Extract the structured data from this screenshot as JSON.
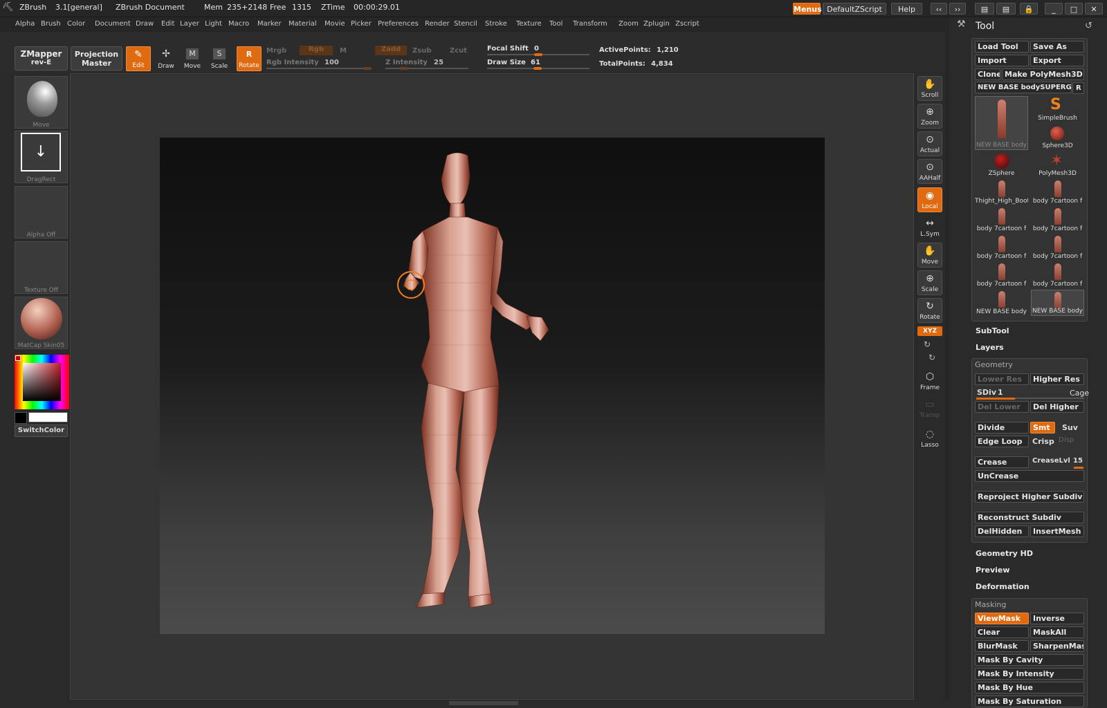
{
  "titlebar": {
    "app": "ZBrush",
    "version": "3.1[general]",
    "doc": "ZBrush Document",
    "mem_label": "Mem",
    "mem_value": "235+2148",
    "free_label": "Free",
    "free_value": "1315",
    "ztime_label": "ZTime",
    "ztime_value": "00:00:29.01",
    "menus_btn": "Menus",
    "script_btn": "DefaultZScript",
    "help_btn": "Help"
  },
  "menubar": [
    "Alpha",
    "Brush",
    "Color",
    "Document",
    "Draw",
    "Edit",
    "Layer",
    "Light",
    "Macro",
    "Marker",
    "Material",
    "Movie",
    "Picker",
    "Preferences",
    "Render",
    "Stencil",
    "Stroke",
    "Texture",
    "Tool",
    "Transform",
    "Zoom",
    "Zplugin",
    "Zscript"
  ],
  "shelf": {
    "zmapper": "ZMapper",
    "zmapper_sub": "rev-E",
    "projection": "Projection",
    "projection_sub": "Master",
    "tools": [
      {
        "label": "Edit",
        "active": true,
        "glyph": "✎"
      },
      {
        "label": "Draw",
        "active": false,
        "glyph": "✢"
      },
      {
        "label": "Move",
        "active": false,
        "glyph": "M"
      },
      {
        "label": "Scale",
        "active": false,
        "glyph": "S"
      },
      {
        "label": "Rotate",
        "active": true,
        "glyph": "R"
      }
    ],
    "mrgb": "Mrgb",
    "rgb": "Rgb",
    "m": "M",
    "zadd": "Zadd",
    "zsub": "Zsub",
    "zcut": "Zcut",
    "rgb_intensity_label": "Rgb Intensity",
    "rgb_intensity": "100",
    "z_intensity_label": "Z Intensity",
    "z_intensity": "25",
    "focal_shift_label": "Focal Shift",
    "focal_shift": "0",
    "draw_size_label": "Draw Size",
    "draw_size": "61",
    "active_points_label": "ActivePoints:",
    "active_points": "1,210",
    "total_points_label": "TotalPoints:",
    "total_points": "4,834"
  },
  "leftpanel": {
    "brush": "Move",
    "stroke": "DragRect",
    "alpha": "Alpha  Off",
    "texture": "Texture  Off",
    "material": "MatCap  Skin05",
    "switch_color": "SwitchColor"
  },
  "rightstrip": [
    {
      "label": "Scroll",
      "glyph": "✋",
      "active": false
    },
    {
      "label": "Zoom",
      "glyph": "⊕",
      "active": false
    },
    {
      "label": "Actual",
      "glyph": "⊙",
      "active": false
    },
    {
      "label": "AAHalf",
      "glyph": "⊙",
      "active": false
    },
    {
      "label": "Local",
      "glyph": "◉",
      "active": true
    },
    {
      "label": "L.Sym",
      "glyph": "↔",
      "active": false
    },
    {
      "label": "Move",
      "glyph": "✋",
      "active": false
    },
    {
      "label": "Scale",
      "glyph": "⊕",
      "active": false
    },
    {
      "label": "Rotate",
      "glyph": "↻",
      "active": false
    }
  ],
  "rightstrip2": {
    "xyz": "XYZ",
    "frame": "Frame",
    "transp": "Transp",
    "lasso": "Lasso"
  },
  "palette": {
    "title": "Tool",
    "load_tool": "Load Tool",
    "save_as": "Save As",
    "import": "Import",
    "export": "Export",
    "clone": "Clone",
    "make_polymesh": "Make PolyMesh3D",
    "current_tool": "NEW  BASE  bodySUPERGI",
    "r_btn": "R",
    "thumbs": [
      {
        "label": "NEW  BASE  body"
      },
      {
        "label": "SimpleBrush"
      },
      {
        "label": "Sphere3D"
      },
      {
        "label": "ZSphere"
      },
      {
        "label": "PolyMesh3D"
      },
      {
        "label": "Thight_High_Boot"
      },
      {
        "label": "body  7cartoon  f"
      },
      {
        "label": "body  7cartoon  f"
      },
      {
        "label": "body  7cartoon  f"
      },
      {
        "label": "body  7cartoon  f"
      },
      {
        "label": "body  7cartoon  f"
      },
      {
        "label": "body  7cartoon  f"
      },
      {
        "label": "body  7cartoon  f"
      },
      {
        "label": "NEW  BASE  body"
      },
      {
        "label": "NEW  BASE  body"
      }
    ],
    "subtool": "SubTool",
    "layers": "Layers",
    "geometry": "Geometry",
    "lower_res": "Lower Res",
    "higher_res": "Higher Res",
    "sdiv_label": "SDiv",
    "sdiv": "1",
    "cage": "Cage",
    "del_lower": "Del Lower",
    "del_higher": "Del Higher",
    "divide": "Divide",
    "smt": "Smt",
    "suv": "Suv",
    "edge_loop": "Edge Loop",
    "crisp": "Crisp",
    "disp": "Disp",
    "crease": "Crease",
    "crease_lvl_label": "CreaseLvl",
    "crease_lvl": "15",
    "uncrease": "UnCrease",
    "reproject": "Reproject Higher Subdiv",
    "reconstruct": "Reconstruct Subdiv",
    "delhidden": "DelHidden",
    "insertmesh": "InsertMesh",
    "geometry_hd": "Geometry HD",
    "preview": "Preview",
    "deformation": "Deformation",
    "masking": "Masking",
    "viewmask": "ViewMask",
    "inverse": "Inverse",
    "clear": "Clear",
    "maskall": "MaskAll",
    "blurmask": "BlurMask",
    "sharpenmask": "SharpenMask",
    "mask_cavity": "Mask By Cavity",
    "mask_intensity": "Mask By Intensity",
    "mask_hue": "Mask By Hue",
    "mask_saturation": "Mask By Saturation"
  },
  "colors": {
    "accent": "#e06a10",
    "bg": "#2a2a2a",
    "skin": "#c98472"
  }
}
